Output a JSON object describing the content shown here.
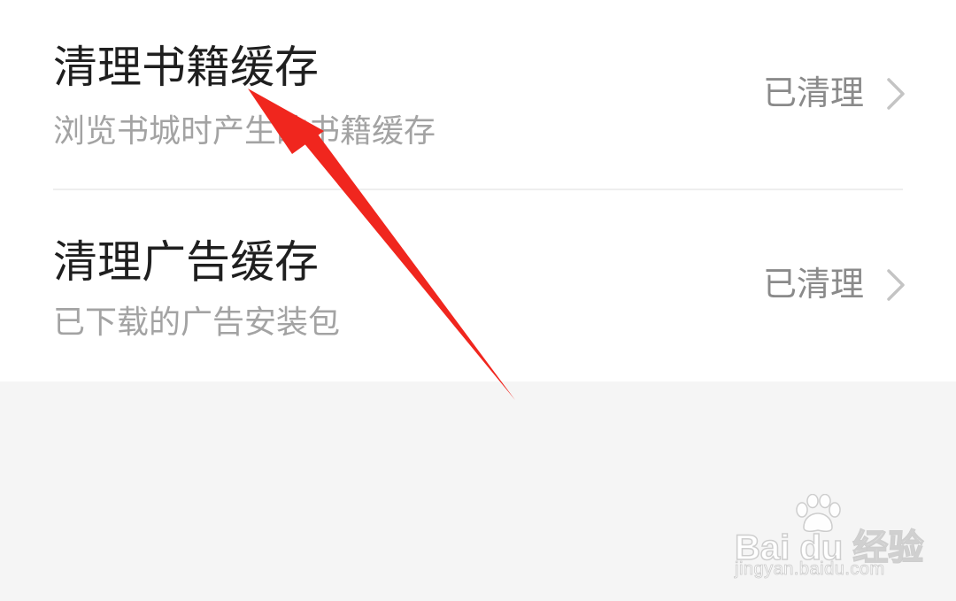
{
  "settings": {
    "items": [
      {
        "title": "清理书籍缓存",
        "subtitle": "浏览书城时产生的书籍缓存",
        "status": "已清理"
      },
      {
        "title": "清理广告缓存",
        "subtitle": "已下载的广告安装包",
        "status": "已清理"
      }
    ]
  },
  "watermark": {
    "logo": "Bai du 经验",
    "url": "jingyan.baidu.com"
  },
  "colors": {
    "annotation_arrow": "#f0261e",
    "background": "#f5f5f5",
    "card": "#ffffff"
  }
}
